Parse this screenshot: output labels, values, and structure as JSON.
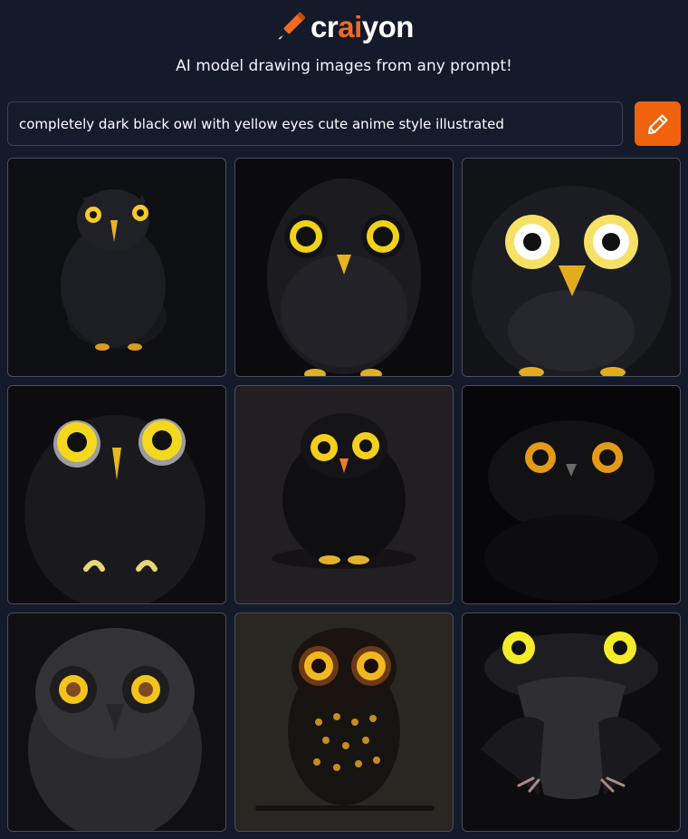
{
  "brand": {
    "prefix": "cr",
    "accent": "ai",
    "suffix": "yon",
    "icon": "pencil-icon",
    "accent_color": "#f26a21"
  },
  "tagline": "AI model drawing images from any prompt!",
  "prompt": {
    "value": "completely dark black owl with yellow eyes cute anime style illustrated",
    "button_icon": "pencil-icon",
    "button_color": "#f0620d"
  },
  "results": {
    "images": [
      "black owl on black background with small yellow eyes",
      "black owl with large yellow ringed eyes",
      "black owl with large glowing white-yellow eyes",
      "black owl with yellow eyes and curled claws",
      "fluffy black owl with yellow eyes",
      "dark owl face with orange eyes",
      "grey owl with glowing yellow eyes",
      "dark owl with orange spots perched on branch",
      "black bird with glowing yellow eyes and feathered wings"
    ]
  }
}
